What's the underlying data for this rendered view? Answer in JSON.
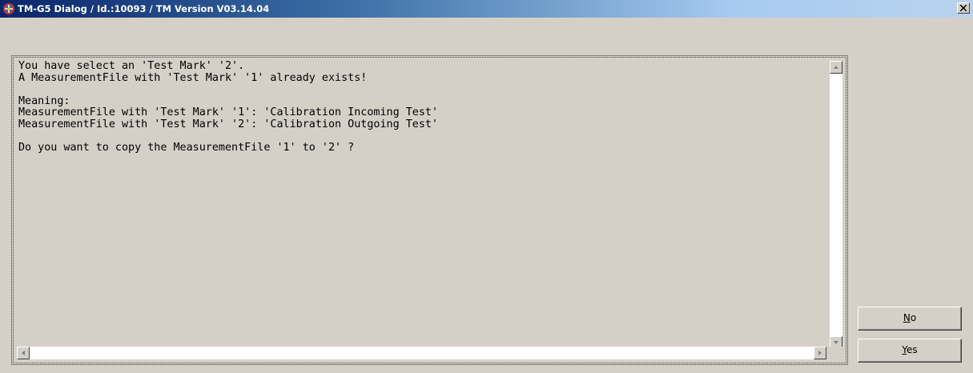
{
  "window": {
    "title": "TM-G5 Dialog / Id.:10093 / TM Version V03.14.04"
  },
  "message": {
    "lines": [
      "You have select an 'Test Mark' '2'.",
      "A MeasurementFile with 'Test Mark' '1' already exists!",
      "",
      "Meaning:",
      "MeasurementFile with 'Test Mark' '1': 'Calibration Incoming Test'",
      "MeasurementFile with 'Test Mark' '2': 'Calibration Outgoing Test'",
      "",
      "Do you want to copy the MeasurementFile '1' to '2' ?"
    ]
  },
  "buttons": {
    "no": {
      "accel": "N",
      "rest": "o"
    },
    "yes": {
      "accel": "Y",
      "rest": "es"
    }
  },
  "icons": {
    "app": "app-logo-icon",
    "close": "close-icon",
    "scroll_up": "scroll-up-arrow-icon",
    "scroll_left": "scroll-left-arrow-icon",
    "scroll_down": "scroll-down-arrow-icon",
    "scroll_right": "scroll-right-arrow-icon"
  },
  "colors": {
    "titlebar_start": "#0a246a",
    "titlebar_end": "#b9d3ee",
    "face": "#d4d0c8"
  }
}
